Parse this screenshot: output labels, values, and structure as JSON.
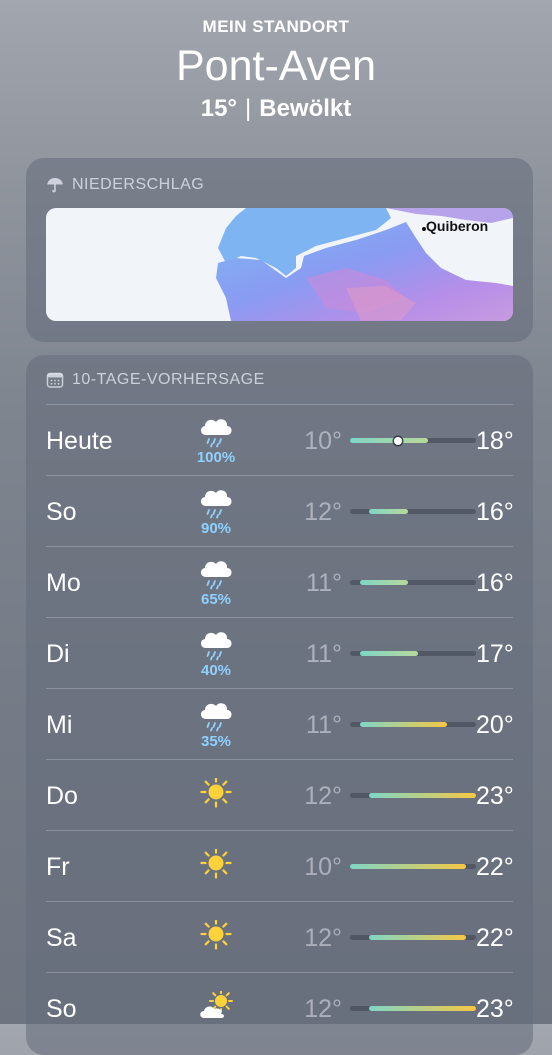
{
  "header": {
    "location_label": "MEIN STANDORT",
    "city": "Pont-Aven",
    "temperature": "15°",
    "separator": "|",
    "condition": "Bewölkt"
  },
  "precipitation": {
    "title": "NIEDERSCHLAG",
    "icon": "umbrella-icon",
    "map_label": "Quiberon"
  },
  "forecast": {
    "title": "10-TAGE-VORHERSAGE",
    "icon": "calendar-icon",
    "scale": {
      "min": 10,
      "max": 23
    },
    "days": [
      {
        "day": "Heute",
        "icon": "rain-cloud-icon",
        "prob": "100%",
        "low": "10°",
        "high": "18°",
        "low_val": 10,
        "high_val": 18,
        "current": 15
      },
      {
        "day": "So",
        "icon": "rain-cloud-icon",
        "prob": "90%",
        "low": "12°",
        "high": "16°",
        "low_val": 12,
        "high_val": 16
      },
      {
        "day": "Mo",
        "icon": "rain-cloud-icon",
        "prob": "65%",
        "low": "11°",
        "high": "16°",
        "low_val": 11,
        "high_val": 16
      },
      {
        "day": "Di",
        "icon": "rain-cloud-icon",
        "prob": "40%",
        "low": "11°",
        "high": "17°",
        "low_val": 11,
        "high_val": 17
      },
      {
        "day": "Mi",
        "icon": "rain-cloud-icon",
        "prob": "35%",
        "low": "11°",
        "high": "20°",
        "low_val": 11,
        "high_val": 20
      },
      {
        "day": "Do",
        "icon": "sun-icon",
        "prob": "",
        "low": "12°",
        "high": "23°",
        "low_val": 12,
        "high_val": 23
      },
      {
        "day": "Fr",
        "icon": "sun-icon",
        "prob": "",
        "low": "10°",
        "high": "22°",
        "low_val": 10,
        "high_val": 22
      },
      {
        "day": "Sa",
        "icon": "sun-icon",
        "prob": "",
        "low": "12°",
        "high": "22°",
        "low_val": 12,
        "high_val": 22
      },
      {
        "day": "So",
        "icon": "partly-cloudy-icon",
        "prob": "",
        "low": "12°",
        "high": "23°",
        "low_val": 12,
        "high_val": 23
      }
    ]
  },
  "colors": {
    "precip_text": "#8fd0ff",
    "sun": "#ffd23a",
    "bar_cool": "#7fd6c6",
    "bar_warm": "#f5c842"
  }
}
